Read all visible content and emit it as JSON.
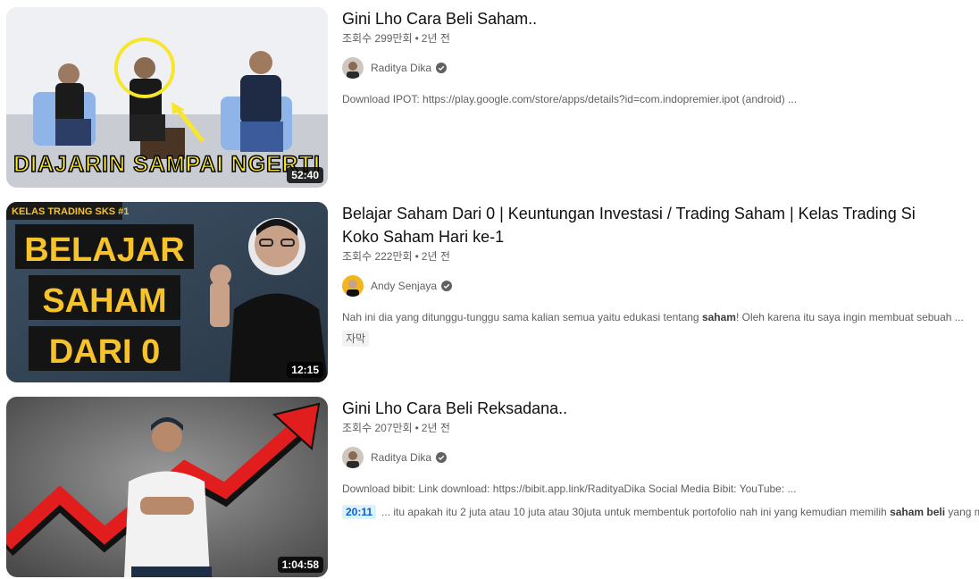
{
  "results": [
    {
      "title": "Gini Lho Cara Beli Saham..",
      "views": "조회수 299만회",
      "age": "2년 전",
      "channel": "Raditya Dika",
      "description": "Download IPOT: https://play.google.com/store/apps/details?id=com.indopremier.ipot (android) ...",
      "duration": "52:40",
      "thumb_text": "DIAJARIN SAMPAI NGERTI"
    },
    {
      "title": "Belajar Saham Dari 0 | Keuntungan Investasi / Trading Saham | Kelas Trading Si Koko Saham Hari ke-1",
      "views": "조회수 222만회",
      "age": "2년 전",
      "channel": "Andy Senjaya",
      "description_before": "Nah ini dia yang ditunggu-tunggu sama kalian semua yaitu edukasi tentang ",
      "description_bold": "saham",
      "description_after": "! Oleh karena itu saya ingin membuat sebuah ...",
      "badge": "자막",
      "duration": "12:15",
      "thumb_tag": "KELAS TRADING SKS #1",
      "thumb_line1": "BELAJAR",
      "thumb_line2": "SAHAM",
      "thumb_line3": "DARI 0"
    },
    {
      "title": "Gini Lho Cara Beli Reksadana..",
      "views": "조회수 207만회",
      "age": "2년 전",
      "channel": "Raditya Dika",
      "description": "Download bibit: Link download: https://bibit.app.link/RadityaDika Social Media Bibit: YouTube: ...",
      "chapter_time": "20:11",
      "chapter_before": "... itu apakah itu 2 juta atau 10 juta atau 30juta untuk membentuk portofolio nah ini yang kemudian memilih ",
      "chapter_bold": "saham beli",
      "chapter_after": " yang m...",
      "duration": "1:04:58"
    }
  ],
  "separator": "•",
  "icons": {
    "verified": "verified-check-icon"
  }
}
